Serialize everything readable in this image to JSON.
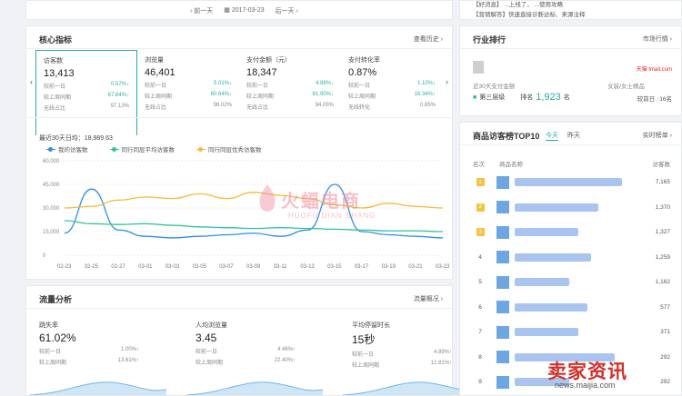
{
  "topbar": {
    "prev_day": "前一天",
    "date": "2017-03-23",
    "next_day": "后一天"
  },
  "notices": [
    "【好消息】   ...上线了，  ...使用攻略",
    "【营销解答】快速直接诊断达标、来源注释"
  ],
  "core": {
    "title": "核心指标",
    "link": "查看历史",
    "tabs": [
      {
        "label": "访客数",
        "value": "13,413",
        "rows": [
          [
            "较前一日",
            "0.57%",
            "down"
          ],
          [
            "较上周同期",
            "67.84%",
            "down"
          ],
          [
            "无线占比",
            "97.13%",
            ""
          ]
        ]
      },
      {
        "label": "浏览量",
        "value": "46,401",
        "rows": [
          [
            "较前一日",
            "5.01%",
            "down"
          ],
          [
            "较上周同期",
            "60.64%",
            "down"
          ],
          [
            "无线占比",
            "98.02%",
            ""
          ]
        ]
      },
      {
        "label": "支付金额（元）",
        "value": "18,347",
        "rows": [
          [
            "较前一日",
            "4.98%",
            "down"
          ],
          [
            "较上周同期",
            "61.90%",
            "down"
          ],
          [
            "无线占比",
            "94.05%",
            ""
          ]
        ]
      },
      {
        "label": "支付转化率",
        "value": "0.87%",
        "rows": [
          [
            "较前一日",
            "1.10%",
            "down"
          ],
          [
            "较上周同期",
            "16.34%",
            "down"
          ],
          [
            "无线转化",
            "0.85%",
            ""
          ]
        ]
      }
    ],
    "avg_text": "最近30天日均：18,989.63"
  },
  "legend": [
    {
      "name": "我的访客数",
      "color": "#2f8fe0"
    },
    {
      "name": "同行同层平均访客数",
      "color": "#2ec4a0"
    },
    {
      "name": "同行同层优秀访客数",
      "color": "#f2b93b"
    }
  ],
  "chart_data": {
    "type": "line",
    "x": [
      "02-23",
      "02-25",
      "02-27",
      "03-01",
      "03-03",
      "03-05",
      "03-07",
      "03-09",
      "03-11",
      "03-13",
      "03-15",
      "03-17",
      "03-19",
      "03-21",
      "03-23"
    ],
    "ylim": [
      0,
      60000
    ],
    "yticks": [
      "60,000",
      "45,000",
      "30,000",
      "15,000",
      "0"
    ],
    "series": [
      {
        "name": "我的访客数",
        "color": "#2f8fe0",
        "values": [
          14000,
          42000,
          16000,
          12000,
          11000,
          12000,
          13000,
          14000,
          12000,
          16000,
          45000,
          15000,
          13000,
          12000,
          11000
        ]
      },
      {
        "name": "同行同层平均访客数",
        "color": "#2ec4a0",
        "values": [
          22000,
          20000,
          19500,
          20000,
          19000,
          18000,
          17500,
          17000,
          17500,
          17000,
          16500,
          16000,
          15500,
          15500,
          15000
        ]
      },
      {
        "name": "同行同层优秀访客数",
        "color": "#f2b93b",
        "values": [
          30000,
          31000,
          35000,
          37000,
          36000,
          39000,
          36000,
          40000,
          38000,
          36000,
          32000,
          30000,
          33000,
          31000,
          30000
        ]
      }
    ]
  },
  "flow": {
    "title": "流量分析",
    "link": "流量概况",
    "cols": [
      {
        "label": "跳失率",
        "value": "61.02%",
        "r1": [
          "较前一日",
          "1.00%"
        ],
        "r2": [
          "较上周同期",
          "13.61%"
        ]
      },
      {
        "label": "人均浏览量",
        "value": "3.45",
        "r1": [
          "较前一日",
          "4.46%"
        ],
        "r2": [
          "较上周同期",
          "22.40%"
        ]
      },
      {
        "label": "平均停留时长",
        "value": "15秒",
        "r1": [
          "较前一日",
          "4.89%"
        ],
        "r2": [
          "较上周同期",
          "12.81%"
        ]
      }
    ]
  },
  "industry": {
    "title": "行业排行",
    "link": "市场行情",
    "site": "天猫 tmall.com",
    "recent_label": "近30天支付金额",
    "level_label": "第三层级",
    "rank_prefix": "排名",
    "rank": "1,923",
    "rank_suffix": "名",
    "category": "女装/女士精品",
    "compare": "较前日",
    "compare_val": "16名"
  },
  "top10": {
    "title": "商品访客榜TOP10",
    "tabs": [
      "今天",
      "昨天"
    ],
    "link": "实时榜单",
    "headers": [
      "名次",
      "商品名称",
      "访客数"
    ],
    "rows": [
      {
        "rank": "1",
        "value": "7,165"
      },
      {
        "rank": "2",
        "value": "1,370"
      },
      {
        "rank": "3",
        "value": "1,327"
      },
      {
        "rank": "4",
        "value": "1,259"
      },
      {
        "rank": "5",
        "value": "1,162"
      },
      {
        "rank": "6",
        "value": "577"
      },
      {
        "rank": "7",
        "value": "371"
      },
      {
        "rank": "8",
        "value": "292"
      },
      {
        "rank": "9",
        "value": "292"
      }
    ]
  },
  "watermarks": {
    "center": "火蝠电商",
    "center_sub": "HUOFU DIAN SHANG",
    "corner": "卖家资讯",
    "corner_sub": "news.maijia.com"
  }
}
